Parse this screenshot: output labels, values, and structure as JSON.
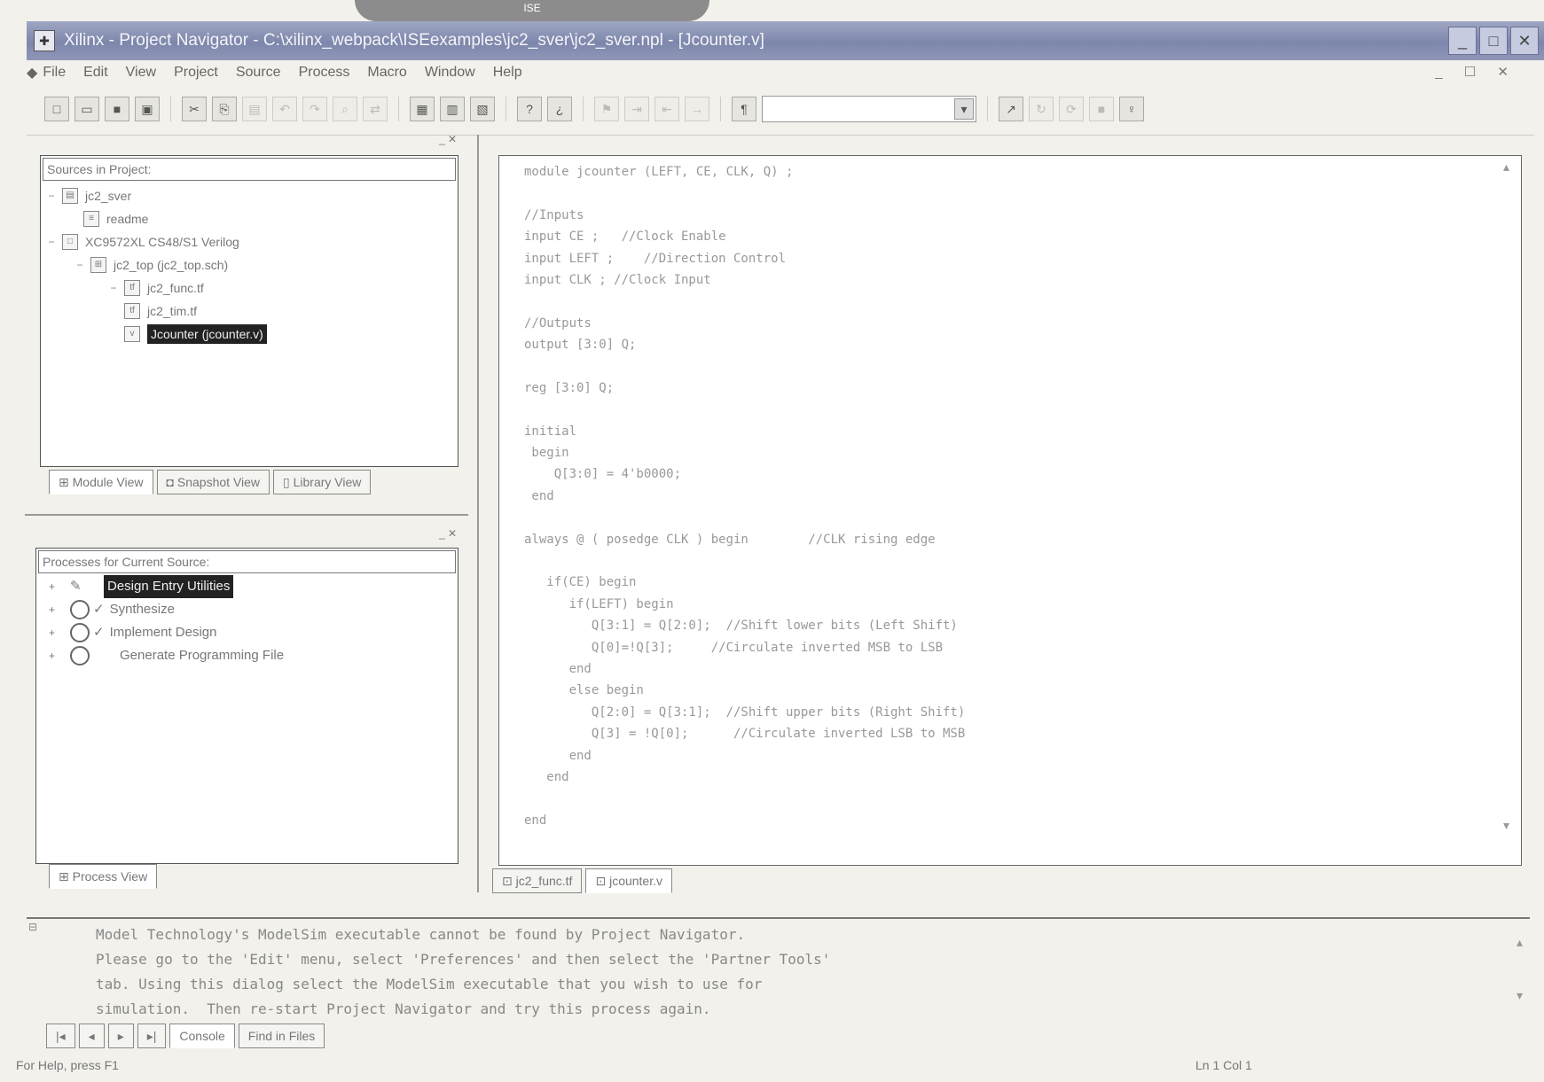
{
  "top_decoration": "ISE",
  "window": {
    "title": "Xilinx - Project Navigator - C:\\xilinx_webpack\\ISEexamples\\jc2_sver\\jc2_sver.npl - [Jcounter.v]",
    "buttons": [
      "_",
      "□",
      "✕"
    ]
  },
  "menubar": {
    "items": [
      "File",
      "Edit",
      "View",
      "Project",
      "Source",
      "Process",
      "Macro",
      "Window",
      "Help"
    ],
    "mdi_controls": "_ ☐ ✕"
  },
  "toolbar": {
    "search_value": ""
  },
  "sources_panel": {
    "header": "Sources in Project:",
    "tree": [
      {
        "label": "jc2_sver",
        "expander": "−"
      },
      {
        "label": "readme",
        "expander": ""
      },
      {
        "label": "XC9572XL CS48/S1 Verilog",
        "expander": "−"
      },
      {
        "label": "jc2_top (jc2_top.sch)",
        "expander": "−"
      },
      {
        "label": "jc2_func.tf",
        "expander": "−"
      },
      {
        "label": "jc2_tim.tf",
        "expander": ""
      },
      {
        "label": "Jcounter (jcounter.v)",
        "expander": ""
      }
    ],
    "tabs": [
      "Module View",
      "Snapshot View",
      "Library View"
    ]
  },
  "process_panel": {
    "header": "Processes for Current Source:",
    "items": [
      {
        "label": "Design Entry Utilities",
        "expander": "+"
      },
      {
        "label": "Synthesize",
        "expander": "+"
      },
      {
        "label": "Implement Design",
        "expander": "+"
      },
      {
        "label": "Generate Programming File",
        "expander": "+"
      }
    ],
    "tabs": [
      "Process View"
    ]
  },
  "editor": {
    "code_lines": [
      "module jcounter (LEFT, CE, CLK, Q) ;",
      "",
      "//Inputs",
      "input CE ;   //Clock Enable",
      "input LEFT ;    //Direction Control",
      "input CLK ; //Clock Input",
      "",
      "//Outputs",
      "output [3:0] Q;",
      "",
      "reg [3:0] Q;",
      "",
      "initial",
      " begin",
      "    Q[3:0] = 4'b0000;",
      " end",
      "",
      "always @ ( posedge CLK ) begin        //CLK rising edge",
      "",
      "   if(CE) begin",
      "      if(LEFT) begin",
      "         Q[3:1] = Q[2:0];  //Shift lower bits (Left Shift)",
      "         Q[0]=!Q[3];     //Circulate inverted MSB to LSB",
      "      end",
      "      else begin",
      "         Q[2:0] = Q[3:1];  //Shift upper bits (Right Shift)",
      "         Q[3] = !Q[0];      //Circulate inverted LSB to MSB",
      "      end",
      "   end",
      "",
      "end"
    ],
    "tabs": [
      "jc2_func.tf",
      "jcounter.v"
    ]
  },
  "console": {
    "lines": [
      "Model Technology's ModelSim executable cannot be found by Project Navigator.",
      "Please go to the 'Edit' menu, select 'Preferences' and then select the 'Partner Tools'",
      "tab. Using this dialog select the ModelSim executable that you wish to use for",
      "simulation.  Then re-start Project Navigator and try this process again."
    ],
    "tabs": [
      "Console",
      "Find in Files"
    ]
  },
  "status": {
    "help_text": "For Help, press F1",
    "position": "Ln 1 Col 1"
  }
}
